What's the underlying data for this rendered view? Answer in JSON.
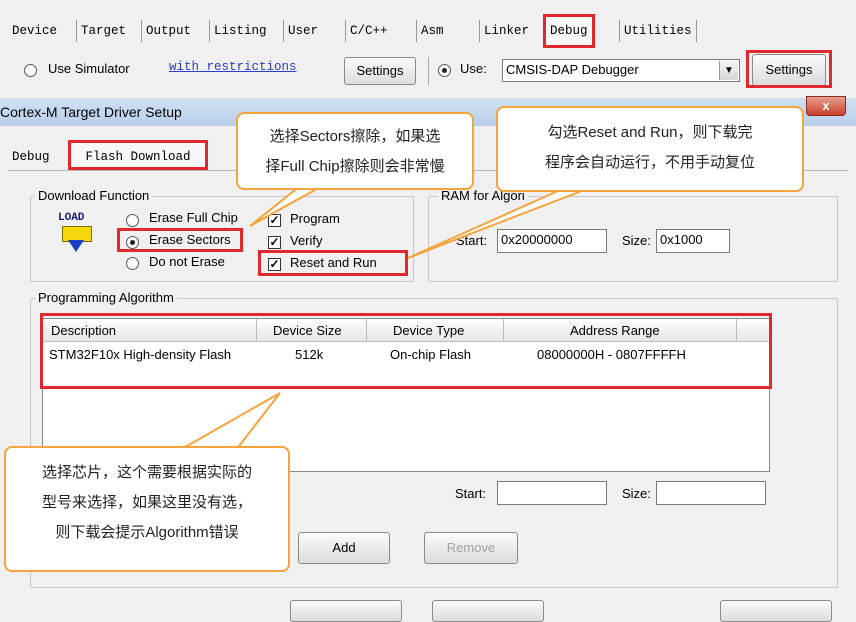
{
  "tabs": [
    {
      "id": "device",
      "label": "Device"
    },
    {
      "id": "target",
      "label": "Target"
    },
    {
      "id": "output",
      "label": "Output"
    },
    {
      "id": "listing",
      "label": "Listing"
    },
    {
      "id": "user",
      "label": "User"
    },
    {
      "id": "cc",
      "label": "C/C++"
    },
    {
      "id": "asm",
      "label": "Asm"
    },
    {
      "id": "linker",
      "label": "Linker"
    },
    {
      "id": "debug",
      "label": "Debug"
    },
    {
      "id": "utilities",
      "label": "Utilities"
    }
  ],
  "debug_bar": {
    "use_simulator": "Use Simulator",
    "with_restrictions": "with restrictions",
    "settings_left": "Settings",
    "use_label": "Use:",
    "debugger": "CMSIS-DAP Debugger",
    "settings_right": "Settings"
  },
  "dialog": {
    "title": "Cortex-M Target Driver Setup",
    "close": "x",
    "tab_debug": "Debug",
    "tab_flash": "Flash Download"
  },
  "download_function": {
    "label": "Download Function",
    "logo_text": "LOAD",
    "erase_full": "Erase Full Chip",
    "erase_sectors": "Erase Sectors",
    "no_erase": "Do not Erase",
    "program": "Program",
    "verify": "Verify",
    "reset_run": "Reset and Run"
  },
  "ram_algorithm": {
    "label": "RAM for Algori",
    "start_label": "Start:",
    "start_value": "0x20000000",
    "size_label": "Size:",
    "size_value": "0x1000"
  },
  "programming_algorithm": {
    "label": "Programming Algorithm",
    "columns": [
      "Description",
      "Device Size",
      "Device Type",
      "Address Range"
    ],
    "rows": [
      [
        "STM32F10x High-density Flash",
        "512k",
        "On-chip Flash",
        "08000000H - 0807FFFFH"
      ]
    ],
    "start_label": "Start:",
    "size_label": "Size:",
    "add": "Add",
    "remove": "Remove"
  },
  "callouts": {
    "sectors": [
      "选择Sectors擦除，如果选",
      "择Full Chip擦除则会非常慢"
    ],
    "reset": [
      "勾选Reset and Run，则下载完",
      "程序会自动运行，不用手动复位"
    ],
    "chip": [
      "选择芯片，这个需要根据实际的",
      "型号来选择，如果这里没有选，",
      "则下载会提示Algorithm错误"
    ]
  },
  "colors": {
    "highlight": "#e0282e",
    "callout_border": "#f5a33b",
    "title_bar": "#bcd3ec"
  }
}
